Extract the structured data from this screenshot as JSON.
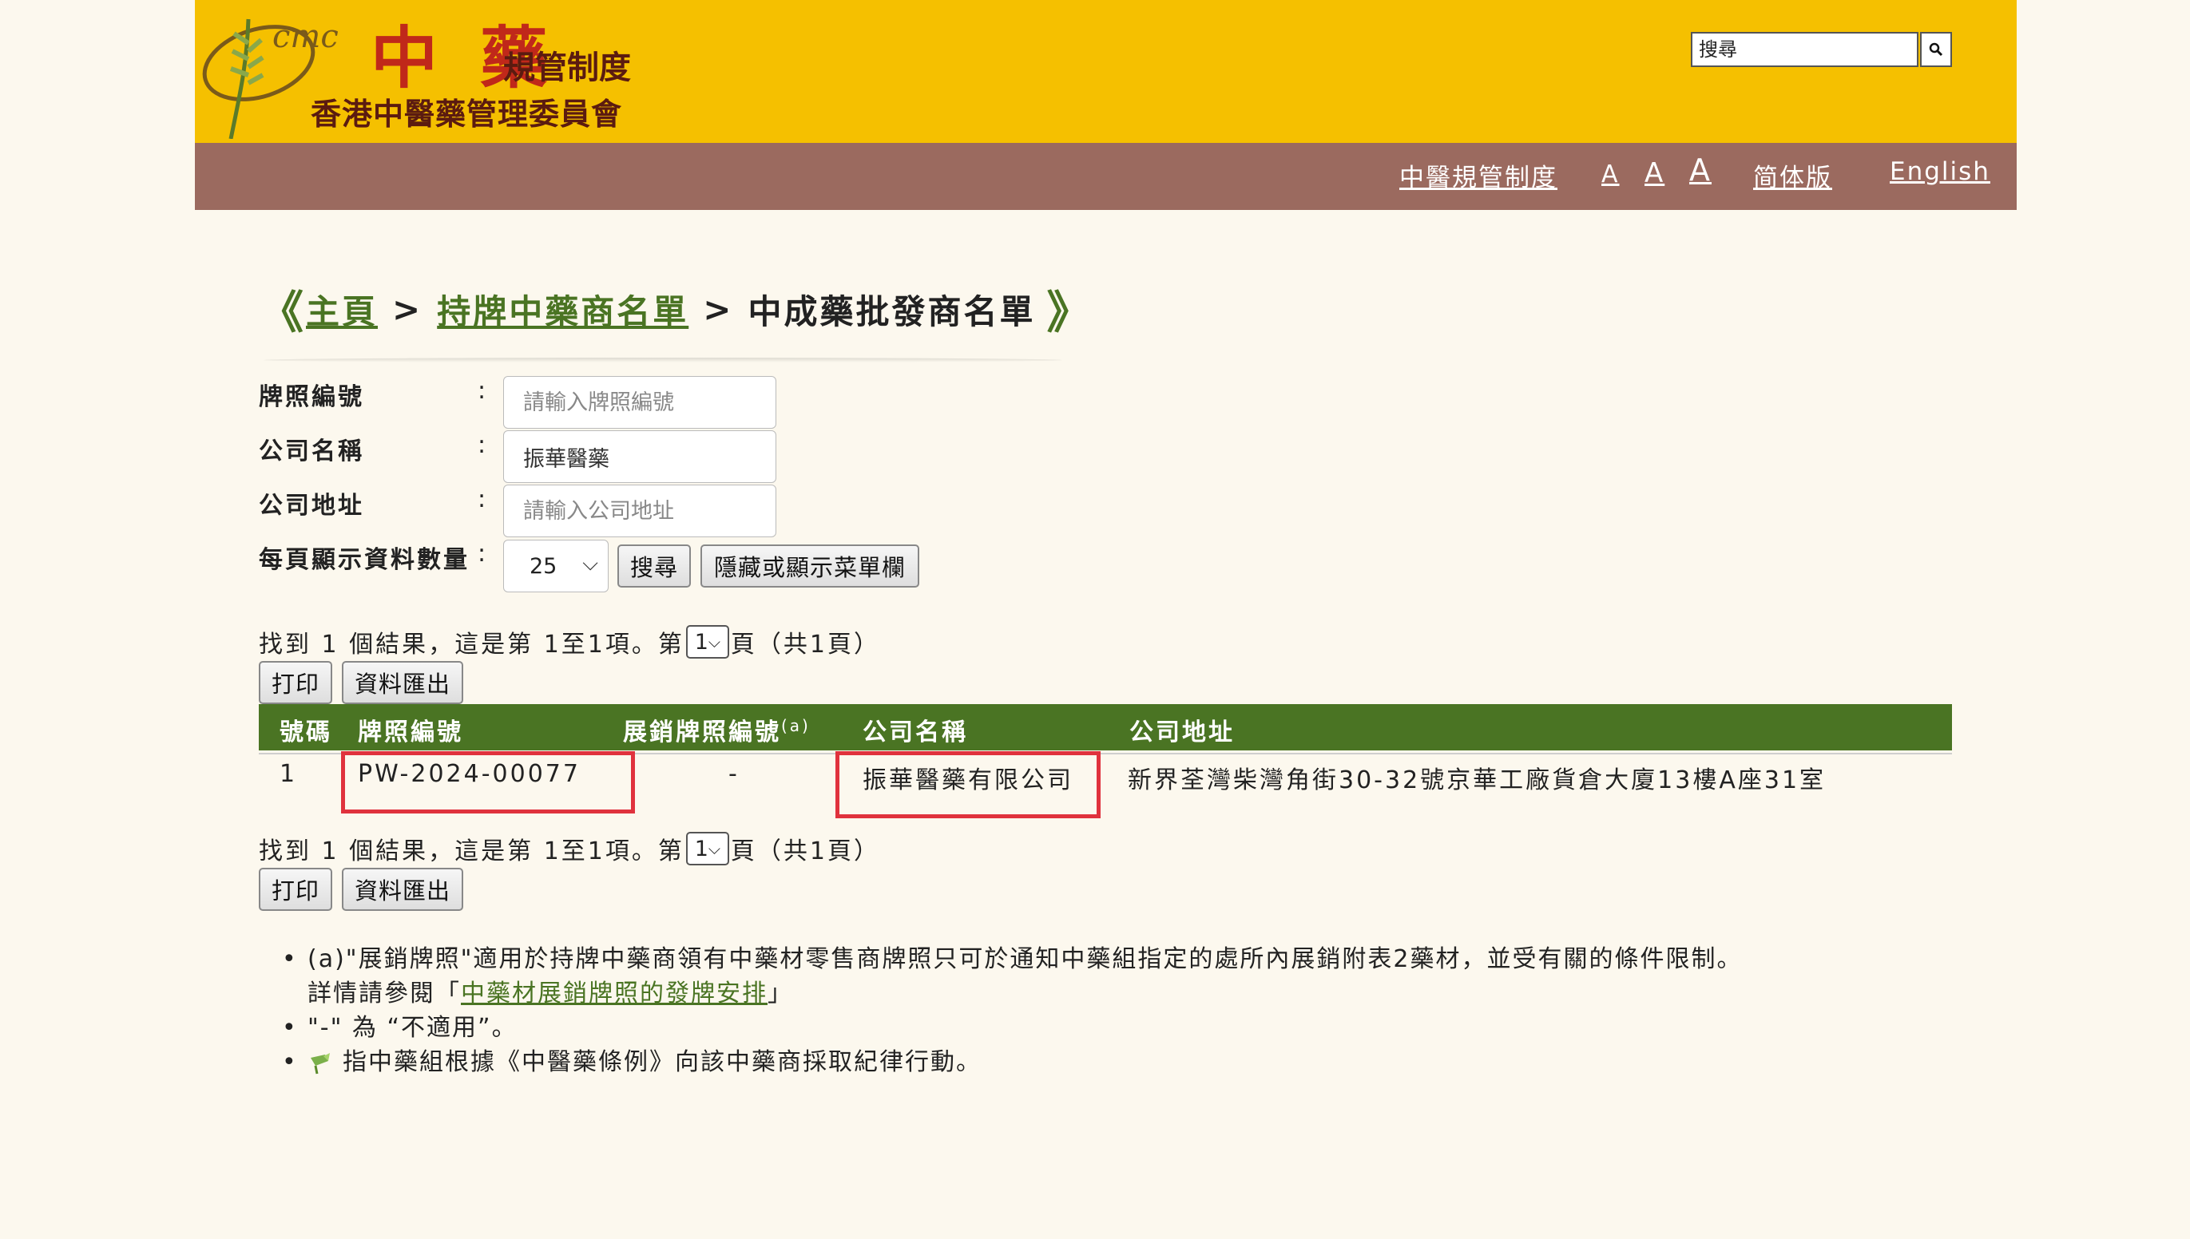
{
  "header": {
    "logo_text_big": "中 藥",
    "logo_text_small": "規管制度",
    "logo_subtitle": "香港中醫藥管理委員會",
    "logo_badge": "cmc",
    "search_placeholder": "搜尋"
  },
  "nav": {
    "items": [
      {
        "label": "中醫規管制度"
      },
      {
        "label": "A"
      },
      {
        "label": "A"
      },
      {
        "label": "A"
      },
      {
        "label": "简体版"
      },
      {
        "label": "English"
      }
    ]
  },
  "breadcrumb": {
    "open_mark": "《",
    "home": "主頁",
    "sep": ">",
    "level1": "持牌中藥商名單",
    "current": "中成藥批發商名單",
    "close_mark": "》"
  },
  "form": {
    "license_label": "牌照編號",
    "license_placeholder": "請輸入牌照編號",
    "license_value": "",
    "company_label": "公司名稱",
    "company_value": "振華醫藥",
    "address_label": "公司地址",
    "address_placeholder": "請輸入公司地址",
    "address_value": "",
    "per_page_label": "每頁顯示資料數量",
    "colon": ":",
    "per_page_value": "25",
    "search_button": "搜尋",
    "toggle_menu_button": "隱藏或顯示菜單欄"
  },
  "results": {
    "summary_prefix": "找到 1 個結果，這是第 1至1項。第",
    "page_value": "1",
    "summary_suffix": "頁（共1頁）",
    "print_button": "打印",
    "export_button": "資料匯出"
  },
  "table": {
    "headers": {
      "no": "號碼",
      "license_no": "牌照編號",
      "display_license": "展銷牌照編號",
      "display_license_sup": "(a)",
      "company": "公司名稱",
      "address": "公司地址"
    },
    "rows": [
      {
        "no": "1",
        "license_no": "PW-2024-00077",
        "display_license": "-",
        "company": "振華醫藥有限公司",
        "address": "新界荃灣柴灣角街30-32號京華工廠貨倉大廈13樓A座31室"
      }
    ]
  },
  "notes": {
    "bullet": "•",
    "note1_line1": "(a)\"展銷牌照\"適用於持牌中藥商領有中藥材零售商牌照只可於通知中藥組指定的處所內展銷附表2藥材，並受有關的條件限制。",
    "note1_line2_prefix": "詳情請參閱「",
    "note1_link": "中藥材展銷牌照的發牌安排",
    "note1_line2_suffix": "」",
    "note2": "\"-\" 為 “不適用”。",
    "note3": "指中藥組根據《中醫藥條例》向該中藥商採取紀律行動。"
  },
  "colors": {
    "header_yellow": "#f5c000",
    "nav_brown": "#9b6a5f",
    "accent_green": "#4a7423",
    "highlight_red": "#e0323d",
    "page_bg": "#fcf8ee"
  }
}
